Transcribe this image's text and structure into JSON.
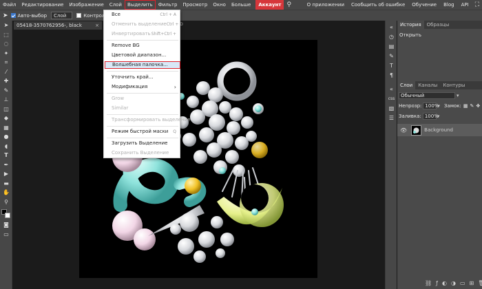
{
  "menubar": {
    "items": [
      "Файл",
      "Редактирование",
      "Изображение",
      "Слой",
      "Выделить",
      "Фильтр",
      "Просмотр",
      "Окно",
      "Больше",
      "Аккаунт"
    ],
    "right_items": [
      "О приложении",
      "Сообщить об ошибке",
      "Обучение",
      "Blog",
      "API"
    ],
    "search_glyph": "⚲",
    "fullscreen_glyph": "⛶"
  },
  "optbar": {
    "auto_select_label": "Авто-выбор",
    "layer_select_value": "Слой",
    "transform_label": "Контроль тра"
  },
  "doc_tab": {
    "title": "05418-3570762956-, black",
    "close": "×"
  },
  "dropdown": {
    "items": [
      {
        "label": "Все",
        "shortcut": "Ctrl + A",
        "disabled": false
      },
      {
        "label": "Отменить выделение",
        "shortcut": "Ctrl + D",
        "disabled": true
      },
      {
        "label": "Инвертировать",
        "shortcut": "Shift+Ctrl + ",
        "disabled": true
      },
      {
        "label": "Remove BG",
        "shortcut": "",
        "disabled": false
      },
      {
        "label": "Цветовой диапазон...",
        "shortcut": "",
        "disabled": false
      },
      {
        "label": "Волшебная палочка...",
        "shortcut": "",
        "disabled": false,
        "active": true
      },
      {
        "label": "Уточнить край...",
        "shortcut": "",
        "disabled": false
      },
      {
        "label": "Модификация",
        "shortcut": "›",
        "disabled": false
      },
      {
        "label": "Grow",
        "shortcut": "",
        "disabled": true
      },
      {
        "label": "Similar",
        "shortcut": "",
        "disabled": true
      },
      {
        "label": "Трансформировать выделение",
        "shortcut": "",
        "disabled": true
      },
      {
        "label": "Режим быстрой маски",
        "shortcut": "Q",
        "disabled": false
      },
      {
        "label": "Загрузить Выделение",
        "shortcut": "",
        "disabled": false
      },
      {
        "label": "Сохранить Выделение",
        "shortcut": "",
        "disabled": true
      }
    ]
  },
  "history_panel": {
    "tabs": [
      "История",
      "Образцы"
    ],
    "entries": [
      "Открыть"
    ]
  },
  "layers_panel": {
    "tabs": [
      "Слои",
      "Каналы",
      "Контуры"
    ],
    "blend_mode": "Обычный",
    "opacity_label": "Непрозр:",
    "opacity_value": "100%",
    "lock_label": "Замок:",
    "fill_label": "Заливка:",
    "fill_value": "100%",
    "layers": [
      {
        "name": "Background",
        "visible": true
      }
    ]
  },
  "colors": {
    "accent_red": "#d6373b",
    "active_item_bg": "#d8e8f7",
    "canvas_bg": "#000000"
  }
}
